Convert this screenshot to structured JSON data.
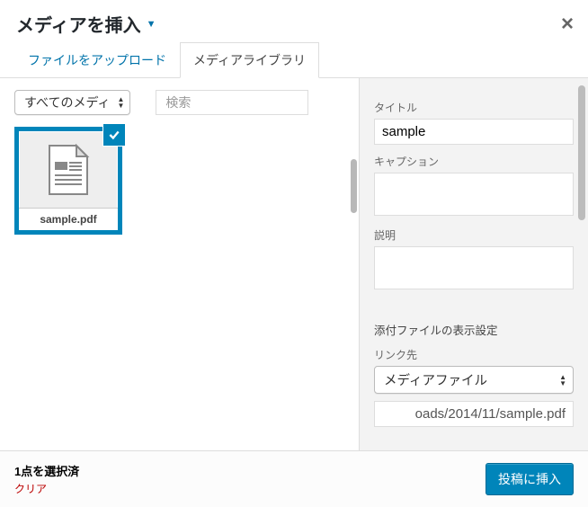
{
  "header": {
    "title": "メディアを挿入",
    "close_label": "×"
  },
  "tabs": {
    "upload": "ファイルをアップロード",
    "library": "メディアライブラリ"
  },
  "toolbar": {
    "filter_selected": "すべてのメディ",
    "search_placeholder": "検索"
  },
  "attachments": [
    {
      "filename": "sample.pdf",
      "icon": "document-icon",
      "selected": true
    }
  ],
  "details": {
    "title_label": "タイトル",
    "title_value": "sample",
    "caption_label": "キャプション",
    "caption_value": "",
    "description_label": "説明",
    "description_value": "",
    "section_heading": "添付ファイルの表示設定",
    "linkto_label": "リンク先",
    "linkto_value": "メディアファイル",
    "url_value": "oads/2014/11/sample.pdf"
  },
  "footer": {
    "selection_text": "1点を選択済",
    "clear_text": "クリア",
    "insert_button": "投稿に挿入"
  }
}
